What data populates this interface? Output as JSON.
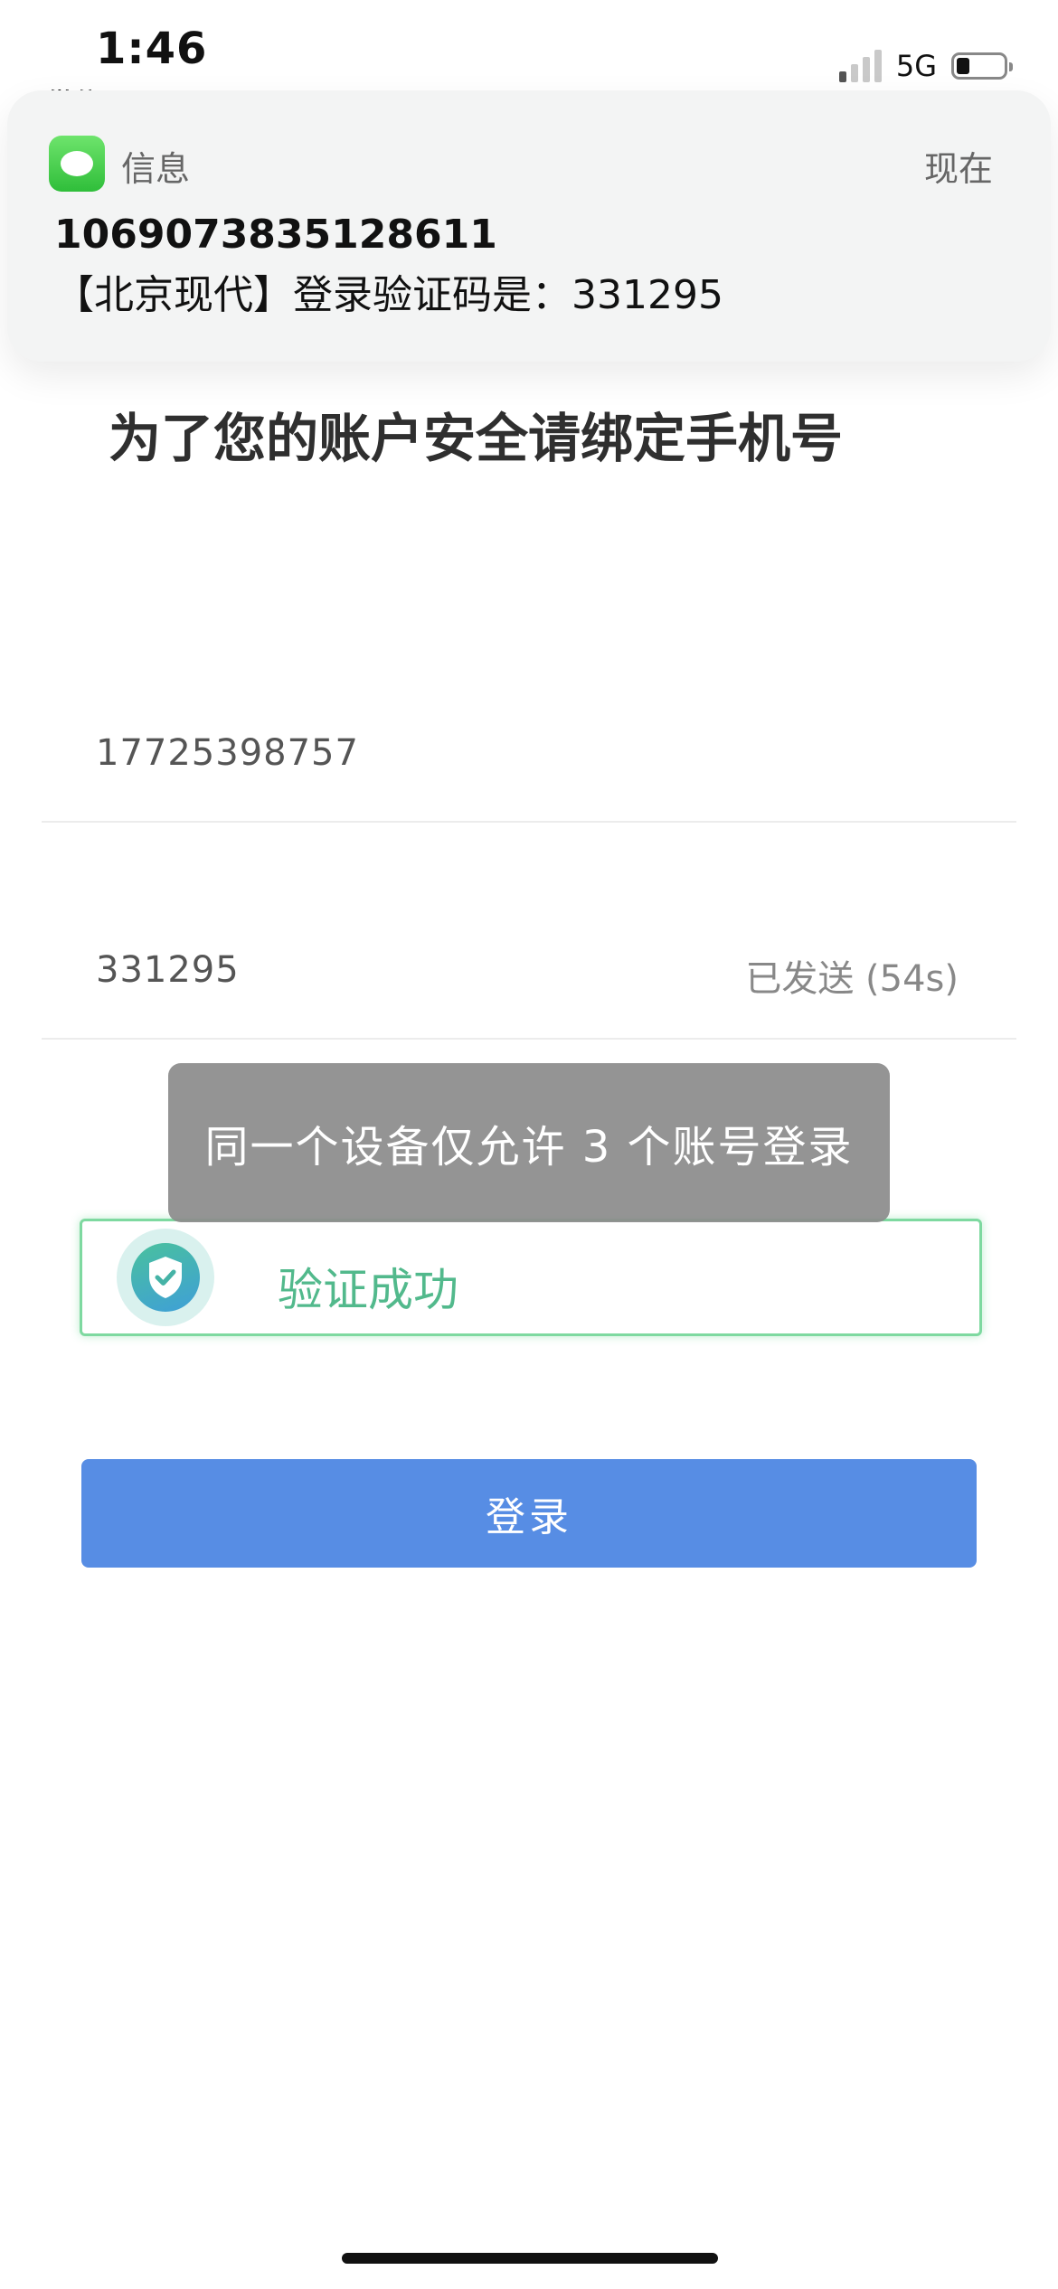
{
  "status_bar": {
    "time": "1:46",
    "back_label": "微信",
    "network": "5G"
  },
  "notification": {
    "app_name": "信息",
    "time": "现在",
    "sender": "1069073835128611",
    "body": "【北京现代】登录验证码是：331295"
  },
  "page": {
    "title": "为了您的账户安全请绑定手机号"
  },
  "form": {
    "phone_value": "17725398757",
    "code_value": "331295",
    "code_status": "已发送 (54s)",
    "verify_text": "验证成功",
    "login_label": "登录"
  },
  "toast": {
    "message": "同一个设备仅允许 3 个账号登录"
  },
  "colors": {
    "primary": "#578de4",
    "success": "#52b98c",
    "toast_bg": "#8c8c8c"
  }
}
